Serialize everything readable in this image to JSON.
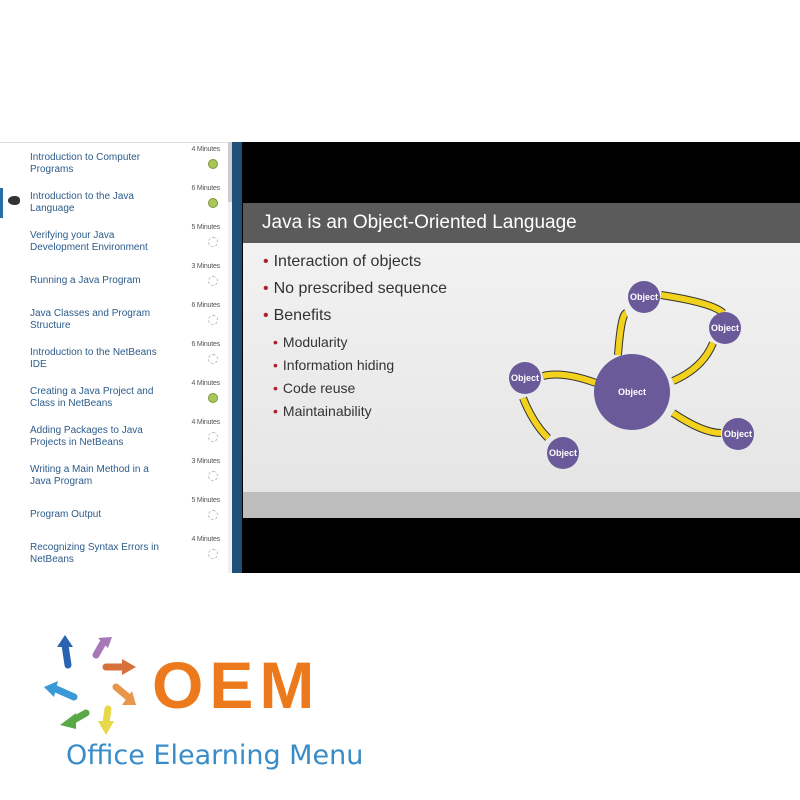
{
  "sidebar": {
    "items": [
      {
        "title": "Introduction to Computer Programs",
        "duration": "4 Minutes",
        "status": "complete"
      },
      {
        "title": "Introduction to the Java Language",
        "duration": "6 Minutes",
        "status": "complete"
      },
      {
        "title": "Verifying your Java Development Environment",
        "duration": "5 Minutes",
        "status": "not-started"
      },
      {
        "title": "Running a Java Program",
        "duration": "3 Minutes",
        "status": "not-started"
      },
      {
        "title": "Java Classes and Program Structure",
        "duration": "6 Minutes",
        "status": "not-started"
      },
      {
        "title": "Introduction to the NetBeans IDE",
        "duration": "6 Minutes",
        "status": "not-started"
      },
      {
        "title": "Creating a Java Project and Class in NetBeans",
        "duration": "4 Minutes",
        "status": "complete"
      },
      {
        "title": "Adding Packages to Java Projects in NetBeans",
        "duration": "4 Minutes",
        "status": "not-started"
      },
      {
        "title": "Writing a Main Method in a Java Program",
        "duration": "3 Minutes",
        "status": "not-started"
      },
      {
        "title": "Program Output",
        "duration": "5 Minutes",
        "status": "not-started"
      },
      {
        "title": "Recognizing Syntax Errors in NetBeans",
        "duration": "4 Minutes",
        "status": "not-started"
      }
    ]
  },
  "slide": {
    "title": "Java is an Object-Oriented Language",
    "bullets": [
      "Interaction of objects",
      "No prescribed sequence",
      "Benefits"
    ],
    "sub_bullets": [
      "Modularity",
      "Information hiding",
      "Code reuse",
      "Maintainability"
    ],
    "node_label": "Object"
  },
  "logo": {
    "mark": "OEM",
    "name": "Office Elearning Menu"
  },
  "colors": {
    "complete": "#a8c65a",
    "node": "#6a5a9a",
    "arrow": "#f2d21c",
    "brand_orange": "#ec7a1c",
    "brand_blue": "#3a8cc8"
  }
}
